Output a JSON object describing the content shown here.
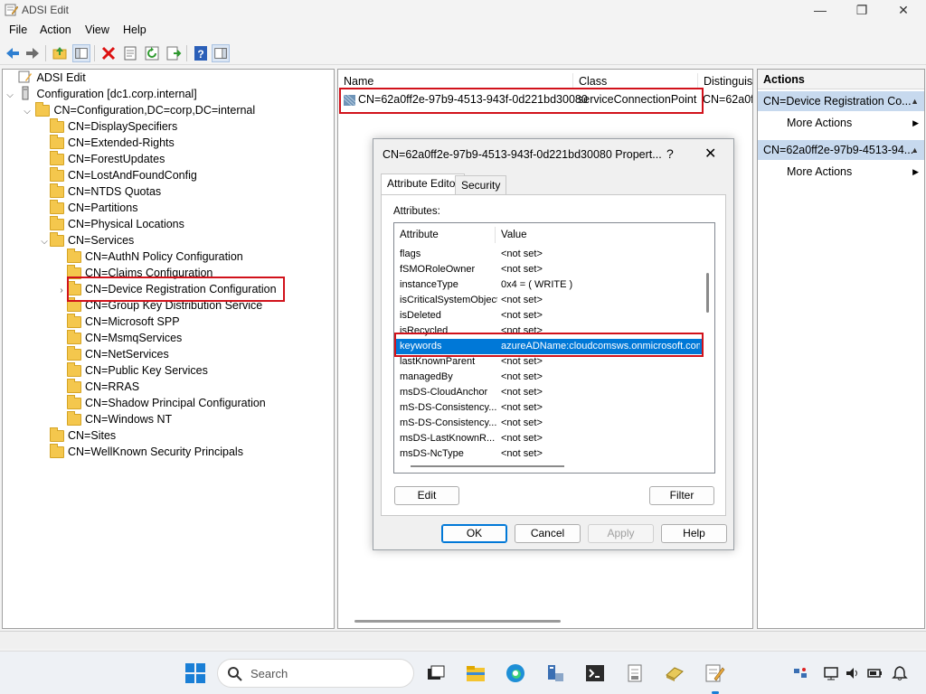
{
  "window": {
    "title": "ADSI Edit",
    "minimize": "—",
    "restore": "❐",
    "close": "✕"
  },
  "menu": [
    "File",
    "Action",
    "View",
    "Help"
  ],
  "toolbar_icons": [
    "back-icon",
    "forward-icon",
    "up-folder-icon",
    "show-hide-tree-icon",
    "delete-icon",
    "properties-icon",
    "refresh-icon",
    "export-list-icon",
    "help-icon",
    "show-hide-action-pane-icon"
  ],
  "tree": {
    "root": "ADSI Edit",
    "configuration": "Configuration [dc1.corp.internal]",
    "config_container": "CN=Configuration,DC=corp,DC=internal",
    "children": [
      "CN=DisplaySpecifiers",
      "CN=Extended-Rights",
      "CN=ForestUpdates",
      "CN=LostAndFoundConfig",
      "CN=NTDS Quotas",
      "CN=Partitions",
      "CN=Physical Locations",
      "CN=Services"
    ],
    "services_children": [
      "CN=AuthN Policy Configuration",
      "CN=Claims Configuration",
      "CN=Device Registration Configuration",
      "CN=Group Key Distribution Service",
      "CN=Microsoft SPP",
      "CN=MsmqServices",
      "CN=NetServices",
      "CN=Public Key Services",
      "CN=RRAS",
      "CN=Shadow Principal Configuration",
      "CN=Windows NT"
    ],
    "after_services": [
      "CN=Sites",
      "CN=WellKnown Security Principals"
    ]
  },
  "list": {
    "columns": [
      "Name",
      "Class",
      "Distinguis"
    ],
    "row": {
      "name": "CN=62a0ff2e-97b9-4513-943f-0d221bd30080",
      "class": "serviceConnectionPoint",
      "dn": "CN=62a0f"
    }
  },
  "actions": {
    "title": "Actions",
    "sections": [
      {
        "header": "CN=Device Registration Co...",
        "item": "More Actions"
      },
      {
        "header": "CN=62a0ff2e-97b9-4513-94...",
        "item": "More Actions"
      }
    ]
  },
  "dialog": {
    "title": "CN=62a0ff2e-97b9-4513-943f-0d221bd30080 Propert...",
    "help": "?",
    "close": "✕",
    "tabs": [
      "Attribute Editor",
      "Security"
    ],
    "attributes_label": "Attributes:",
    "columns": [
      "Attribute",
      "Value"
    ],
    "rows": [
      {
        "attr": "flags",
        "value": "<not set>"
      },
      {
        "attr": "fSMORoleOwner",
        "value": "<not set>"
      },
      {
        "attr": "instanceType",
        "value": "0x4 = ( WRITE )"
      },
      {
        "attr": "isCriticalSystemObject",
        "value": "<not set>"
      },
      {
        "attr": "isDeleted",
        "value": "<not set>"
      },
      {
        "attr": "isRecycled",
        "value": "<not set>"
      },
      {
        "attr": "keywords",
        "value": "azureADName:cloudcomsws.onmicrosoft.com"
      },
      {
        "attr": "lastKnownParent",
        "value": "<not set>"
      },
      {
        "attr": "managedBy",
        "value": "<not set>"
      },
      {
        "attr": "msDS-CloudAnchor",
        "value": "<not set>"
      },
      {
        "attr": "mS-DS-Consistency...",
        "value": "<not set>"
      },
      {
        "attr": "mS-DS-Consistency...",
        "value": "<not set>"
      },
      {
        "attr": "msDS-LastKnownR...",
        "value": "<not set>"
      },
      {
        "attr": "msDS-NcType",
        "value": "<not set>"
      }
    ],
    "selected_row": 6,
    "edit_button": "Edit",
    "filter_button": "Filter",
    "ok_button": "OK",
    "cancel_button": "Cancel",
    "apply_button": "Apply",
    "help_button": "Help"
  },
  "taskbar": {
    "search_placeholder": "Search",
    "apps": [
      "start-icon",
      "search-icon",
      "task-view-icon",
      "file-explorer-icon",
      "edge-icon",
      "server-manager-icon",
      "terminal-icon",
      "notepad-icon",
      "printer-icon",
      "adsi-edit-icon"
    ],
    "tray": [
      "network-icon",
      "display-icon",
      "volume-icon",
      "battery-icon",
      "notifications-icon"
    ]
  },
  "colors": {
    "highlight_box": "#d1121b",
    "selection": "#0078d7",
    "actions_section": "#c7d9ee"
  }
}
